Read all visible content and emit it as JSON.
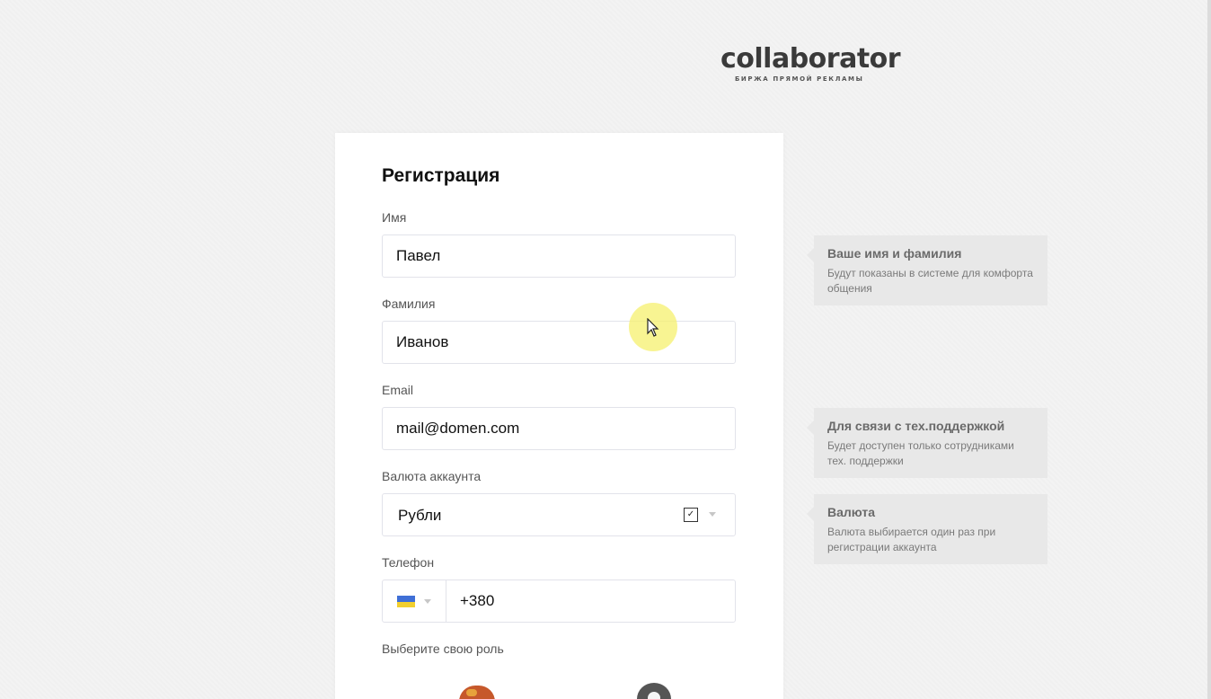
{
  "brand": {
    "name": "collaborator",
    "tagline": "БИРЖА ПРЯМОЙ РЕКЛАМЫ"
  },
  "form": {
    "title": "Регистрация",
    "first_name": {
      "label": "Имя",
      "value": "Павел"
    },
    "last_name": {
      "label": "Фамилия",
      "value": "Иванов"
    },
    "email": {
      "label": "Email",
      "value": "mail@domen.com"
    },
    "currency": {
      "label": "Валюта аккаунта",
      "selected": "Рубли"
    },
    "phone": {
      "label": "Телефон",
      "country": "UA",
      "value": "+380"
    },
    "role": {
      "label": "Выберите свою роль"
    }
  },
  "hints": [
    {
      "title": "Ваше имя и фамилия",
      "text": "Будут показаны в системе для комфорта общения"
    },
    {
      "title": "Для связи с тех.поддержкой",
      "text": "Будет доступен только сотрудниками тех. поддержки"
    },
    {
      "title": "Валюта",
      "text": "Валюта выбирается один раз при регистрации аккаунта"
    }
  ],
  "colors": {
    "background": "#f3f3f3",
    "card": "#ffffff",
    "hint_bg": "#e8e8e8",
    "field_border": "#e2e3ea",
    "cursor_highlight": "#f5f06e"
  }
}
